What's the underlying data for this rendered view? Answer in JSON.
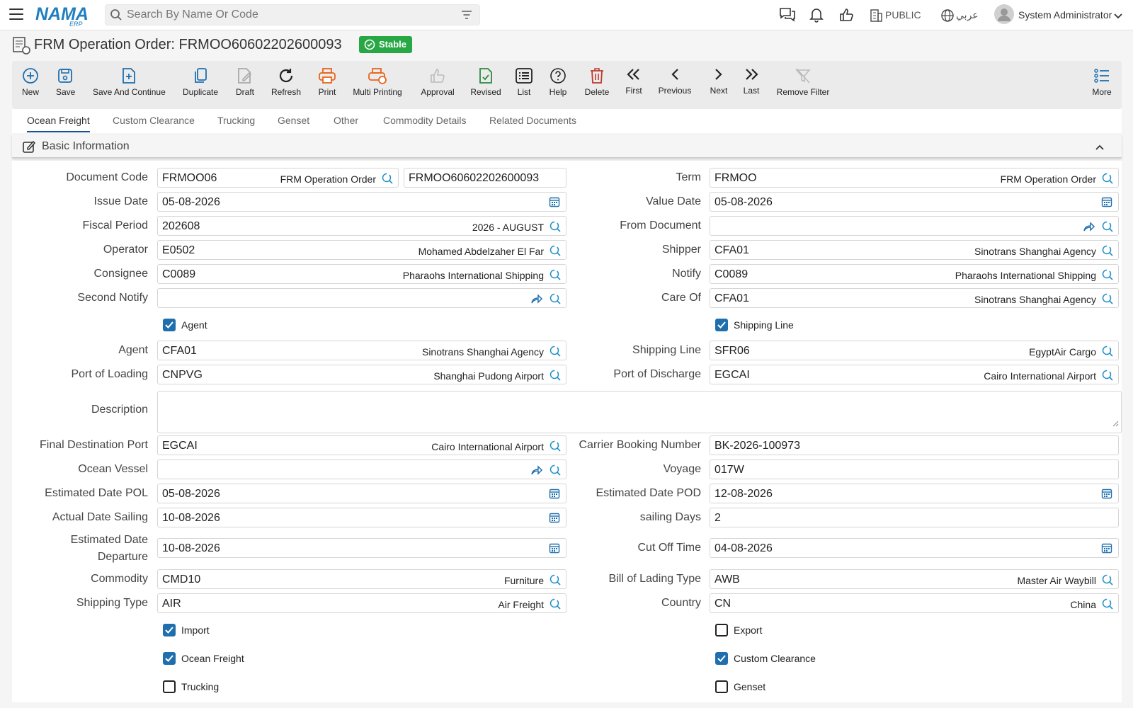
{
  "header": {
    "search_placeholder": "Search By Name Or Code",
    "public_label": "PUBLIC",
    "language_label": "عربي",
    "user_name": "System Administrator",
    "logo_text": "NAMA",
    "logo_sub": "ERP"
  },
  "page": {
    "title": "FRM Operation Order: FRMOO60602202600093",
    "status": "Stable"
  },
  "toolbar": {
    "items": [
      {
        "label": "New",
        "icon": "plus-circle-icon"
      },
      {
        "label": "Save",
        "icon": "save-icon"
      },
      {
        "label": "Save And Continue",
        "icon": "file-plus-icon"
      },
      {
        "label": "Duplicate",
        "icon": "copy-icon"
      },
      {
        "label": "Draft",
        "icon": "draft-icon"
      },
      {
        "label": "Refresh",
        "icon": "refresh-icon"
      },
      {
        "label": "Print",
        "icon": "print-icon"
      },
      {
        "label": "Multi Printing",
        "icon": "multi-print-icon"
      },
      {
        "label": "Approval",
        "icon": "thumbs-up-icon"
      },
      {
        "label": "Revised",
        "icon": "file-check-icon"
      },
      {
        "label": "List",
        "icon": "list-icon"
      },
      {
        "label": "Help",
        "icon": "help-icon"
      },
      {
        "label": "Delete",
        "icon": "trash-icon"
      },
      {
        "label": "First",
        "icon": "first-icon"
      },
      {
        "label": "Previous",
        "icon": "previous-icon"
      },
      {
        "label": "Next",
        "icon": "next-icon"
      },
      {
        "label": "Last",
        "icon": "last-icon"
      },
      {
        "label": "Remove Filter",
        "icon": "remove-filter-icon"
      },
      {
        "label": "More",
        "icon": "more-icon"
      }
    ]
  },
  "tabs": [
    {
      "label": "Ocean Freight",
      "active": true
    },
    {
      "label": "Custom Clearance"
    },
    {
      "label": "Trucking"
    },
    {
      "label": "Genset"
    },
    {
      "label": "Other"
    },
    {
      "label": "Commodity Details"
    },
    {
      "label": "Related Documents"
    }
  ],
  "section": {
    "title": "Basic Information"
  },
  "form": {
    "document_code": {
      "label": "Document Code",
      "value": "FRMOO06",
      "desc": "FRM Operation Order",
      "code": "FRMOO60602202600093"
    },
    "term": {
      "label": "Term",
      "value": "FRMOO",
      "desc": "FRM Operation Order"
    },
    "issue_date": {
      "label": "Issue Date",
      "value": "05-08-2026"
    },
    "value_date": {
      "label": "Value Date",
      "value": "05-08-2026"
    },
    "fiscal_period": {
      "label": "Fiscal Period",
      "value": "202608",
      "desc": "2026 - AUGUST"
    },
    "from_document": {
      "label": "From Document",
      "value": ""
    },
    "operator": {
      "label": "Operator",
      "value": "E0502",
      "desc": "Mohamed Abdelzaher El Far"
    },
    "shipper": {
      "label": "Shipper",
      "value": "CFA01",
      "desc": "Sinotrans Shanghai Agency"
    },
    "consignee": {
      "label": "Consignee",
      "value": "C0089",
      "desc": "Pharaohs International Shipping"
    },
    "notify": {
      "label": "Notify",
      "value": "C0089",
      "desc": "Pharaohs International Shipping"
    },
    "second_notify": {
      "label": "Second Notify",
      "value": ""
    },
    "care_of": {
      "label": "Care Of",
      "value": "CFA01",
      "desc": "Sinotrans Shanghai Agency"
    },
    "agent_check": {
      "label": "Agent",
      "checked": true
    },
    "shipping_line_check": {
      "label": "Shipping Line",
      "checked": true
    },
    "agent": {
      "label": "Agent",
      "value": "CFA01",
      "desc": "Sinotrans Shanghai Agency"
    },
    "shipping_line": {
      "label": "Shipping Line",
      "value": "SFR06",
      "desc": "EgyptAir Cargo"
    },
    "port_loading": {
      "label": "Port of Loading",
      "value": "CNPVG",
      "desc": "Shanghai Pudong Airport"
    },
    "port_discharge": {
      "label": "Port of Discharge",
      "value": "EGCAI",
      "desc": "Cairo International Airport"
    },
    "description": {
      "label": "Description",
      "value": ""
    },
    "final_destination": {
      "label": "Final Destination Port",
      "value": "EGCAI",
      "desc": "Cairo International Airport"
    },
    "carrier_booking": {
      "label": "Carrier Booking Number",
      "value": "BK-2026-100973"
    },
    "ocean_vessel": {
      "label": "Ocean Vessel",
      "value": ""
    },
    "voyage": {
      "label": "Voyage",
      "value": "017W"
    },
    "est_date_pol": {
      "label": "Estimated Date POL",
      "value": "05-08-2026"
    },
    "est_date_pod": {
      "label": "Estimated Date POD",
      "value": "12-08-2026"
    },
    "actual_sailing": {
      "label": "Actual Date Sailing",
      "value": "10-08-2026"
    },
    "sailing_days": {
      "label": "sailing Days",
      "value": "2"
    },
    "est_departure": {
      "label1": "Estimated Date",
      "label2": "Departure",
      "value": "10-08-2026"
    },
    "cut_off": {
      "label": "Cut Off Time",
      "value": "04-08-2026"
    },
    "commodity": {
      "label": "Commodity",
      "value": "CMD10",
      "desc": "Furniture"
    },
    "bol_type": {
      "label": "Bill of Lading Type",
      "value": "AWB",
      "desc": "Master Air Waybill"
    },
    "shipping_type": {
      "label": "Shipping Type",
      "value": "AIR",
      "desc": "Air Freight"
    },
    "country": {
      "label": "Country",
      "value": "CN",
      "desc": "China"
    },
    "import": {
      "label": "Import",
      "checked": true
    },
    "export": {
      "label": "Export",
      "checked": false
    },
    "ocean_freight": {
      "label": "Ocean Freight",
      "checked": true
    },
    "custom_clearance": {
      "label": "Custom Clearance",
      "checked": true
    },
    "trucking": {
      "label": "Trucking",
      "checked": false
    },
    "genset": {
      "label": "Genset",
      "checked": false
    }
  },
  "colors": {
    "accent": "#1f6fae",
    "status_green": "#28a745",
    "print_orange": "#e8641b",
    "delete_red": "#c0392b"
  }
}
